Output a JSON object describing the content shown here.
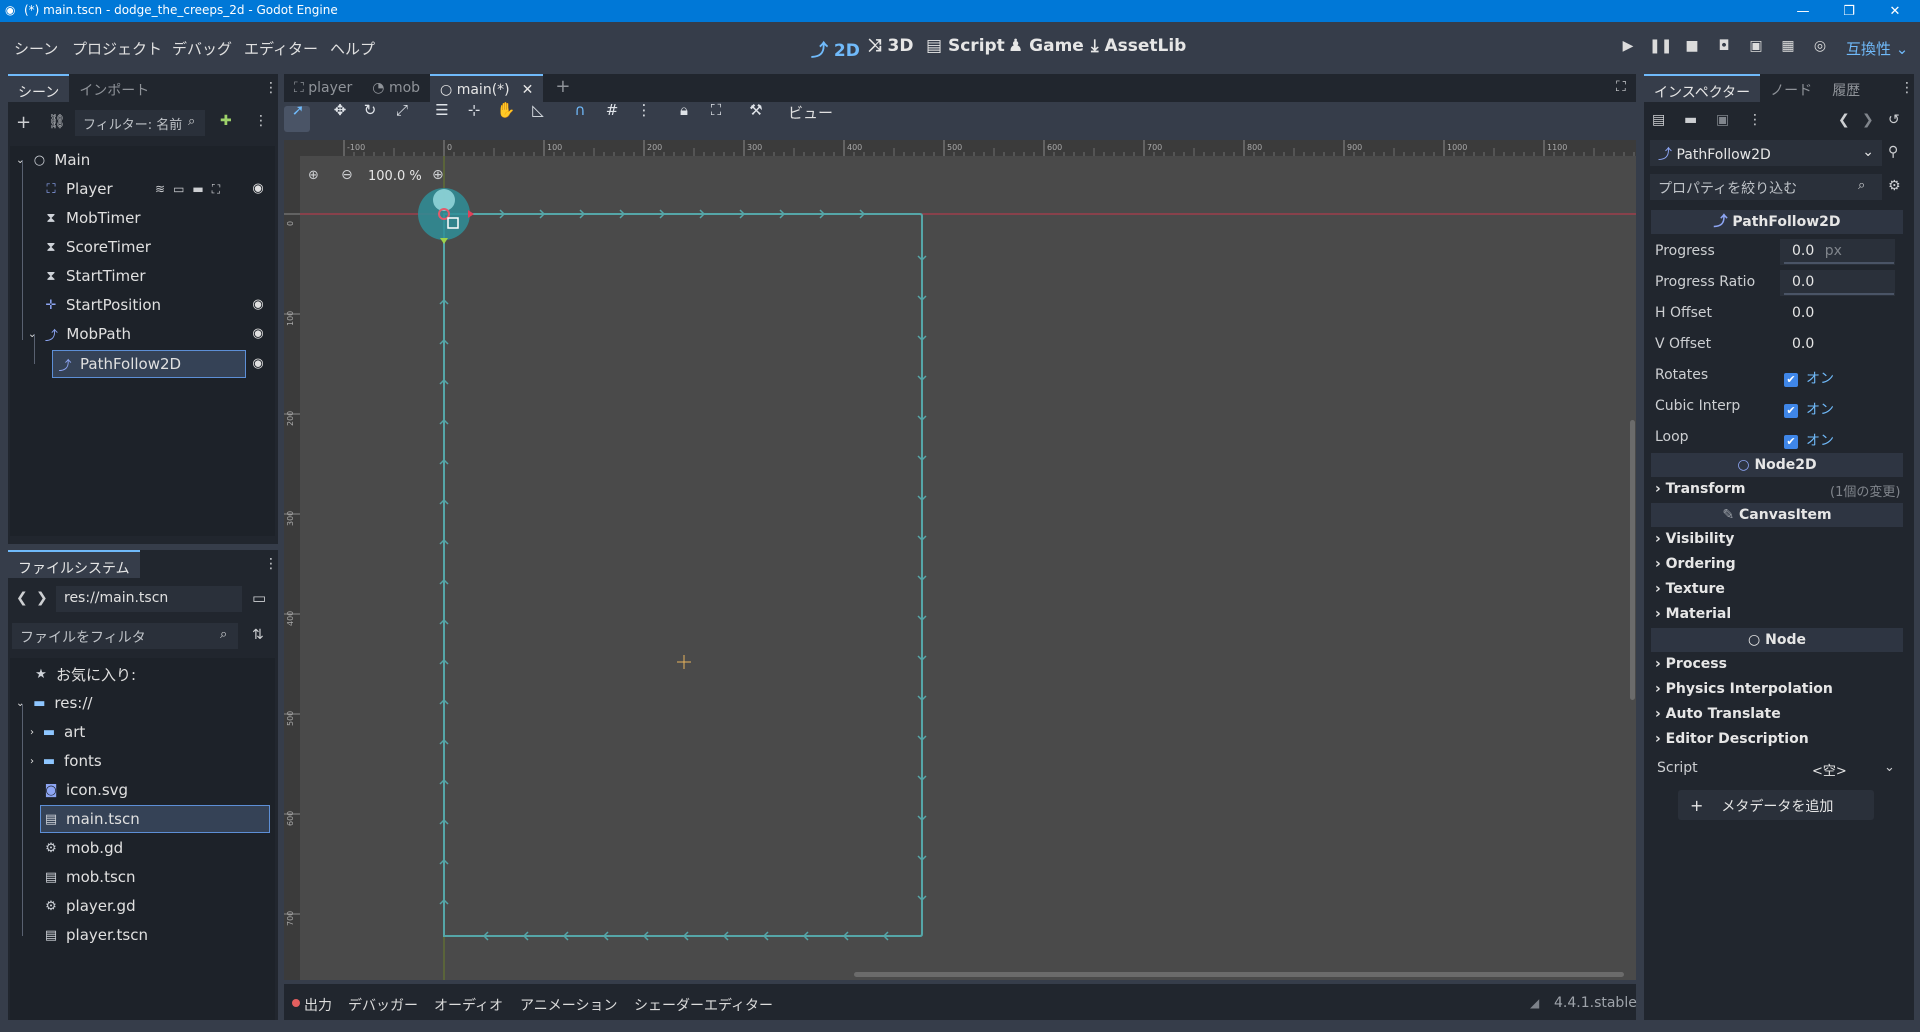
{
  "window": {
    "title": "(*) main.tscn - dodge_the_creeps_2d - Godot Engine"
  },
  "menu": [
    "シーン",
    "プロジェクト",
    "デバッグ",
    "エディター",
    "ヘルプ"
  ],
  "modes": [
    "2D",
    "3D",
    "Script",
    "Game",
    "AssetLib"
  ],
  "compat_label": "互換性",
  "scene_panel": {
    "tabs": [
      "シーン",
      "インポート"
    ],
    "filter_placeholder": "フィルター: 名前",
    "nodes": [
      {
        "name": "Main",
        "icon": "circle-icon"
      },
      {
        "name": "Player",
        "icon": "area-icon"
      },
      {
        "name": "MobTimer",
        "icon": "timer-icon"
      },
      {
        "name": "ScoreTimer",
        "icon": "timer-icon"
      },
      {
        "name": "StartTimer",
        "icon": "timer-icon"
      },
      {
        "name": "StartPosition",
        "icon": "marker-icon"
      },
      {
        "name": "MobPath",
        "icon": "path-icon"
      },
      {
        "name": "PathFollow2D",
        "icon": "path-follow-icon"
      }
    ]
  },
  "fs_panel": {
    "tab": "ファイルシステム",
    "path": "res://main.tscn",
    "filter_placeholder": "ファイルをフィルタ",
    "favorites": "お気に入り:",
    "root": "res://",
    "items": [
      "art",
      "fonts",
      "icon.svg",
      "main.tscn",
      "mob.gd",
      "mob.tscn",
      "player.gd",
      "player.tscn"
    ]
  },
  "editor_tabs": [
    "player",
    "mob",
    "main(*)"
  ],
  "toolbar": {
    "view_label": "ビュー"
  },
  "viewport": {
    "zoom": "100.0 %",
    "ruler_labels": [
      "-100",
      "0",
      "100",
      "200",
      "300",
      "400",
      "500",
      "600",
      "700",
      "800",
      "900",
      "1000",
      "1100"
    ],
    "vruler_labels": [
      "0",
      "100",
      "200",
      "300",
      "400",
      "500",
      "600",
      "700"
    ]
  },
  "bottom_tabs": [
    "出力",
    "デバッガー",
    "オーディオ",
    "アニメーション",
    "シェーダーエディター"
  ],
  "version": "4.4.1.stable",
  "inspector": {
    "tabs": [
      "インスペクター",
      "ノード",
      "履歴"
    ],
    "node_name": "PathFollow2D",
    "filter_placeholder": "プロパティを絞り込む",
    "class": "PathFollow2D",
    "props": [
      {
        "label": "Progress",
        "value": "0.0",
        "unit": "px"
      },
      {
        "label": "Progress Ratio",
        "value": "0.0",
        "unit": ""
      },
      {
        "label": "H Offset",
        "value": "0.0",
        "unit": ""
      },
      {
        "label": "V Offset",
        "value": "0.0",
        "unit": ""
      }
    ],
    "checks": [
      {
        "label": "Rotates",
        "value": "オン"
      },
      {
        "label": "Cubic Interp",
        "value": "オン"
      },
      {
        "label": "Loop",
        "value": "オン"
      }
    ],
    "node2d": "Node2D",
    "transform": "Transform",
    "transform_note": "(1個の変更)",
    "canvasitem": "CanvasItem",
    "canvas_sections": [
      "Visibility",
      "Ordering",
      "Texture",
      "Material"
    ],
    "node": "Node",
    "node_sections": [
      "Process",
      "Physics Interpolation",
      "Auto Translate",
      "Editor Description"
    ],
    "script_label": "Script",
    "script_value": "<空>",
    "add_meta": "メタデータを追加"
  }
}
